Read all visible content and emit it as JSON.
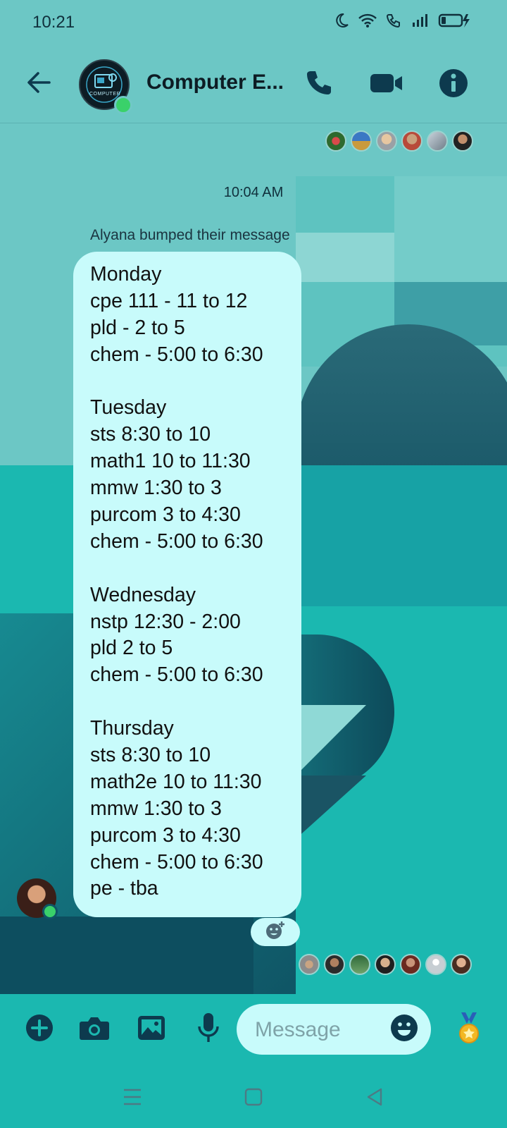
{
  "status_bar": {
    "time": "10:21",
    "icons": [
      "moon-icon",
      "wifi-icon",
      "wifi-call-icon",
      "signal-icon",
      "battery-charging-icon"
    ]
  },
  "header": {
    "title": "Computer E...",
    "avatar_text": "COMPUTER",
    "icons": [
      "back-arrow-icon",
      "phone-icon",
      "video-camera-icon",
      "info-icon"
    ]
  },
  "chat": {
    "timestamp": "10:04 AM",
    "bump_notice": "Alyana bumped their message",
    "message_lines": [
      "Monday",
      "cpe 111 - 11 to 12",
      "pld - 2 to 5",
      "chem - 5:00 to 6:30",
      "",
      "Tuesday",
      "sts 8:30 to 10",
      "math1 10 to 11:30",
      "mmw 1:30 to 3",
      "purcom 3 to 4:30",
      "chem - 5:00 to 6:30",
      "",
      "Wednesday",
      "nstp 12:30 - 2:00",
      "pld 2 to 5",
      "chem - 5:00 to 6:30",
      "",
      "Thursday",
      "sts 8:30 to 10",
      "math2e 10 to 11:30",
      "mmw 1:30 to 3",
      "purcom 3 to 4:30",
      "chem - 5:00 to 6:30",
      "pe - tba"
    ]
  },
  "composer": {
    "placeholder": "Message",
    "icons": [
      "plus-icon",
      "camera-icon",
      "image-icon",
      "microphone-icon",
      "emoji-icon",
      "medal-icon"
    ]
  },
  "navigation": {
    "icons": [
      "menu-icon",
      "home-icon",
      "back-triangle-icon"
    ]
  },
  "colors": {
    "background": "#1bb8b0",
    "bubble": "#c8fbfb",
    "icon_dark": "#0d3a4e"
  }
}
